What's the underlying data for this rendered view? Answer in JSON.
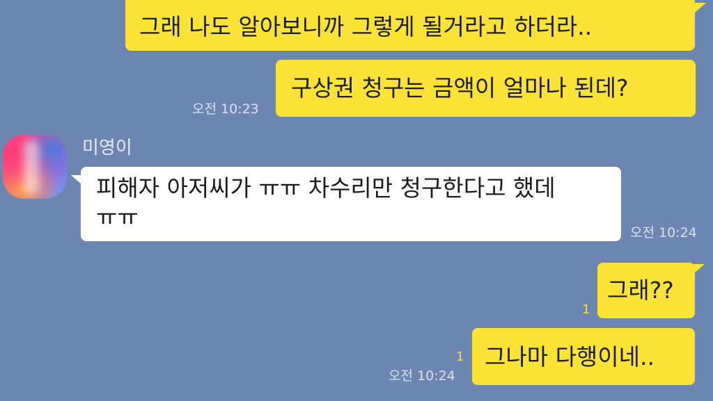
{
  "chat": {
    "messages": [
      {
        "sender": "me",
        "text": "그래 나도 알아보니까 그렇게 될거라고 하더라.."
      },
      {
        "sender": "me",
        "text": "구상권  청구는 금액이 얼마나 된데?",
        "time": "오전 10:23"
      },
      {
        "sender": "미영이",
        "text_line1": "피해자 아저씨가 ㅠㅠ 차수리만 청구한다고  했데",
        "text_line2": "ㅠㅠ",
        "time": "오전 10:24"
      },
      {
        "sender": "me",
        "text": "그래??",
        "unread": "1"
      },
      {
        "sender": "me",
        "text": "그나마 다행이네..",
        "unread": "1",
        "time": "오전 10:24"
      }
    ],
    "contact": {
      "name": "미영이",
      "avatar_icon": "gradient-avatar-icon"
    }
  },
  "colors": {
    "background": "#6b86b1",
    "my_bubble": "#fbe335",
    "their_bubble": "#ffffff",
    "unread": "#f6e04a"
  }
}
